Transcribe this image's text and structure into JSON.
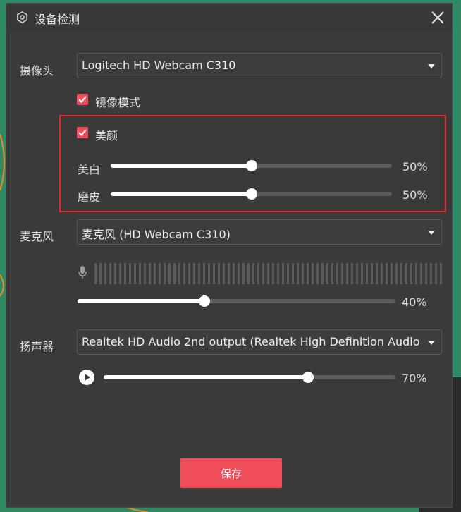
{
  "dialog": {
    "title": "设备检测"
  },
  "camera": {
    "label": "摄像头",
    "selected": "Logitech HD Webcam C310",
    "mirror": {
      "label": "镜像模式",
      "checked": true
    },
    "beauty": {
      "label": "美颜",
      "checked": true,
      "whitening": {
        "label": "美白",
        "value": 50,
        "text": "50%"
      },
      "smoothing": {
        "label": "磨皮",
        "value": 50,
        "text": "50%"
      }
    }
  },
  "microphone": {
    "label": "麦克风",
    "selected": "麦克风 (HD Webcam C310)",
    "volume": {
      "value": 40,
      "text": "40%"
    }
  },
  "speaker": {
    "label": "扬声器",
    "selected": "Realtek HD Audio 2nd output (Realtek High Definition Audio",
    "volume": {
      "value": 70,
      "text": "70%"
    }
  },
  "actions": {
    "save_label": "保存"
  },
  "colors": {
    "accent": "#f04e59",
    "highlight_border": "#e82a2a",
    "panel": "#3a3a3a",
    "background": "#2f8a63"
  },
  "icons": [
    "settings-icon",
    "close-icon",
    "chevron-down-icon",
    "check-icon",
    "microphone-icon",
    "play-icon"
  ]
}
